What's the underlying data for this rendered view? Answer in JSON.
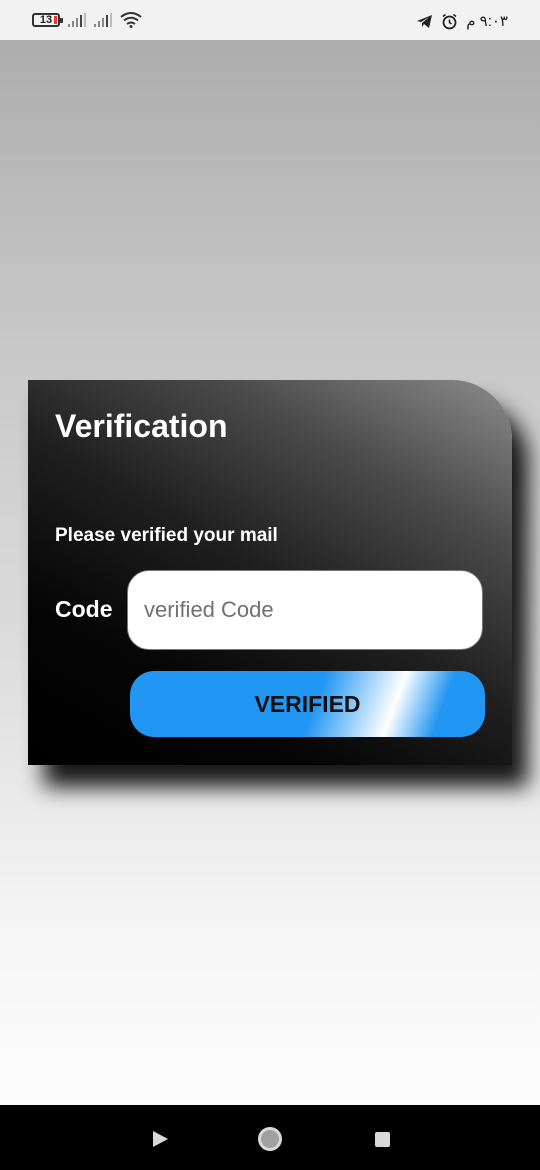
{
  "status_bar": {
    "battery_level": "13",
    "time": "٩:٠٣ م",
    "icons": [
      "battery-icon",
      "signal-icon",
      "signal-icon",
      "wifi-icon",
      "telegram-icon",
      "alarm-icon"
    ]
  },
  "card": {
    "title": "Verification",
    "subtitle": "Please verified your mail",
    "code_label": "Code",
    "code_input": {
      "value": "",
      "placeholder": "verified Code"
    },
    "verify_button_label": "VERIFIED"
  },
  "nav": {
    "icons": [
      "back-icon",
      "home-icon",
      "recents-icon"
    ]
  },
  "colors": {
    "accent": "#2196f3",
    "card_dark": "#000000",
    "battery_low": "#e53935"
  }
}
